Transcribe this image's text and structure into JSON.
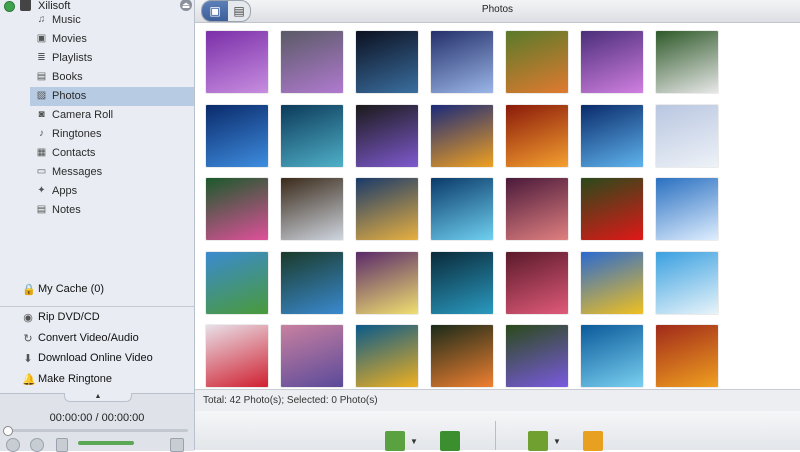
{
  "device": {
    "name": "Xilisoft",
    "eject_icon": "eject-icon"
  },
  "nav": [
    {
      "label": "Music",
      "icon": "music-note-icon",
      "glyph": "♫"
    },
    {
      "label": "Movies",
      "icon": "film-icon",
      "glyph": "▣"
    },
    {
      "label": "Playlists",
      "icon": "playlist-icon",
      "glyph": "≣"
    },
    {
      "label": "Books",
      "icon": "book-icon",
      "glyph": "▤"
    },
    {
      "label": "Photos",
      "icon": "photo-icon",
      "glyph": "▨",
      "selected": true
    },
    {
      "label": "Camera Roll",
      "icon": "camera-icon",
      "glyph": "◙"
    },
    {
      "label": "Ringtones",
      "icon": "bell-icon",
      "glyph": "♪"
    },
    {
      "label": "Contacts",
      "icon": "contacts-icon",
      "glyph": "▦"
    },
    {
      "label": "Messages",
      "icon": "message-icon",
      "glyph": "▭"
    },
    {
      "label": "Apps",
      "icon": "apps-icon",
      "glyph": "✦"
    },
    {
      "label": "Notes",
      "icon": "notes-icon",
      "glyph": "▤"
    }
  ],
  "cache": {
    "label": "My Cache (0)",
    "icon": "cache-lock-icon"
  },
  "tools": [
    {
      "label": "Rip DVD/CD",
      "icon": "disc-icon",
      "glyph": "◉"
    },
    {
      "label": "Convert Video/Audio",
      "icon": "convert-icon",
      "glyph": "↻"
    },
    {
      "label": "Download Online Video",
      "icon": "download-icon",
      "glyph": "⬇"
    },
    {
      "label": "Make Ringtone",
      "icon": "ringtone-bell-icon",
      "glyph": "🔔"
    }
  ],
  "player": {
    "time": "00:00:00 / 00:00:00",
    "progress": 0
  },
  "topbar": {
    "title": "Photos"
  },
  "photos": [
    [
      "#7b2fa8",
      "#c78ee0"
    ],
    [
      "#5a5a66",
      "#b07ad0"
    ],
    [
      "#0c1020",
      "#3a6fa0"
    ],
    [
      "#24306a",
      "#9bb6e8"
    ],
    [
      "#5a7a2a",
      "#e07a30"
    ],
    [
      "#4b2e7a",
      "#d07fe0"
    ],
    [
      "#2f5a2a",
      "#e8e8e8"
    ],
    [
      "#0a2a6a",
      "#3e8de0"
    ],
    [
      "#0c3a5a",
      "#4fb0c8"
    ],
    [
      "#1a1a1a",
      "#7f5ad0"
    ],
    [
      "#1a2a7a",
      "#f0a020"
    ],
    [
      "#8a1a0a",
      "#f5a030"
    ],
    [
      "#0a2a6a",
      "#5fb4ee"
    ],
    [
      "#b8c6e0",
      "#eef2f8"
    ],
    [
      "#1a5a2a",
      "#e0509a"
    ],
    [
      "#3a2a1a",
      "#cfd6e0"
    ],
    [
      "#1a3a6a",
      "#e8b040"
    ],
    [
      "#0a3a6a",
      "#6fd0f0"
    ],
    [
      "#4a1a3a",
      "#e08080"
    ],
    [
      "#2a4a1a",
      "#e01818"
    ],
    [
      "#2a70c0",
      "#dfeeff"
    ],
    [
      "#3a8ad0",
      "#4a9a3a"
    ],
    [
      "#1a3a2a",
      "#3a8ad0"
    ],
    [
      "#5a2a6a",
      "#f0e070"
    ],
    [
      "#0a2a3a",
      "#2a9ac0"
    ],
    [
      "#5a1a2a",
      "#e05a7a"
    ],
    [
      "#2a6ad0",
      "#f0c020"
    ],
    [
      "#3aa0e0",
      "#e8f4fa"
    ],
    [
      "#e8e0e8",
      "#d02030"
    ],
    [
      "#c880a0",
      "#5a4a9a"
    ],
    [
      "#0a5a8a",
      "#f0b020"
    ],
    [
      "#1a2a1a",
      "#f08030"
    ],
    [
      "#2a4a1a",
      "#7a5ae0"
    ],
    [
      "#0a5a9a",
      "#7ad0f0"
    ],
    [
      "#a02a1a",
      "#f0a020"
    ]
  ],
  "status": {
    "text": "Total: 42 Photo(s); Selected: 0 Photo(s)"
  },
  "toolbar": [
    {
      "name": "add-to-device-icon",
      "color": "#5aa140",
      "has_caret": true
    },
    {
      "name": "export-to-pc-icon",
      "color": "#3b8f2f",
      "has_caret": false
    },
    {
      "name": "add-photo-folder-icon",
      "color": "#6fa030",
      "has_caret": true
    },
    {
      "name": "delete-x-icon",
      "color": "#e8a020",
      "has_caret": false
    }
  ]
}
